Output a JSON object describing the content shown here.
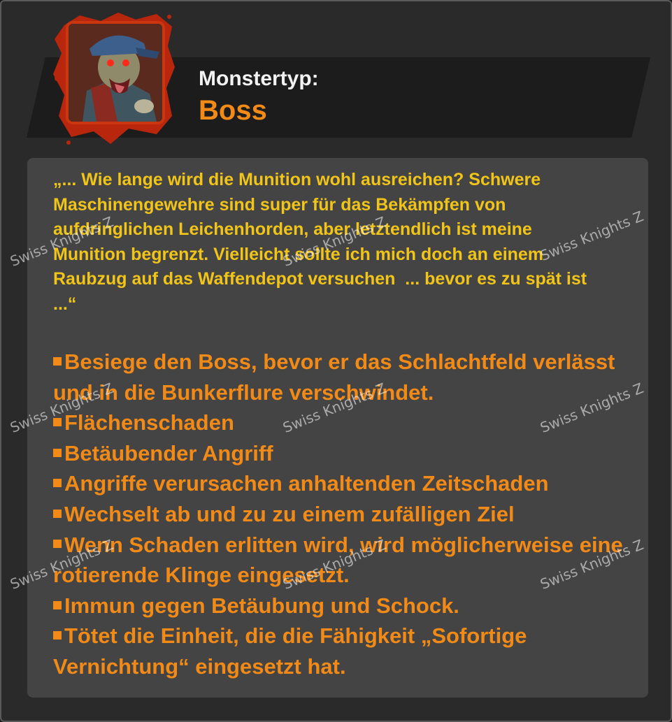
{
  "header": {
    "monster_type_label": "Monstertyp:",
    "monster_type_value": "Boss",
    "avatar_alt": "Zombie-Boss Porträt"
  },
  "quote": {
    "text": "„... Wie lange wird die Munition wohl ausreichen? Schwere Maschinengewehre sind super für das Bekämpfen von aufdringlichen Leichenhorden, aber letztendlich ist meine Munition begrenzt. Vielleicht sollte ich mich doch an einem Raubzug auf das Waffendepot versuchen  ... bevor es zu spät ist  ...“"
  },
  "features": [
    "Besiege den Boss, bevor er das Schlachtfeld verlässt und in die Bunkerflure verschwindet.",
    "Flächenschaden",
    "Betäubender Angriff",
    "Angriffe verursachen anhaltenden Zeitschaden",
    "Wechselt ab und zu zu einem zufälligen Ziel",
    "Wenn Schaden erlitten wird, wird möglicherweise eine rotierende Klinge eingesetzt.",
    "Immun gegen Betäubung und Schock.",
    "Tötet die Einheit, die die Fähigkeit „Sofortige Vernichtung“ eingesetzt hat."
  ],
  "watermark": "Swiss Knights Z",
  "colors": {
    "accent_orange": "#f28a17",
    "quote_yellow": "#f0c419",
    "panel_gray": "#444444",
    "avatar_border": "#c9360f"
  }
}
